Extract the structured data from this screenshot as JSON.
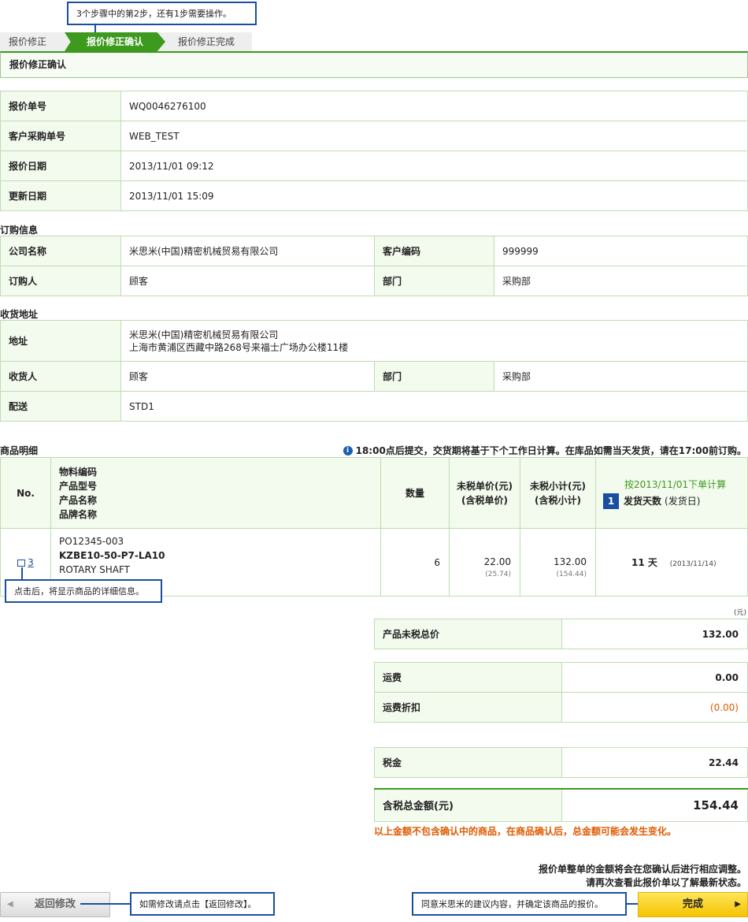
{
  "callouts": {
    "step": "3个步骤中的第2步，还有1步需要操作。",
    "detail": "点击后，将显示商品的详细信息。",
    "back": "如需修改请点击【返回修改】。",
    "confirm": "同意米思米的建议内容，并确定该商品的报价。"
  },
  "steps": [
    "报价修正",
    "报价修正确认",
    "报价修正完成"
  ],
  "page_title": "报价修正确认",
  "quote": {
    "rows": [
      {
        "label": "报价单号",
        "value": "WQ0046276100"
      },
      {
        "label": "客户采购单号",
        "value": "WEB_TEST"
      },
      {
        "label": "报价日期",
        "value": "2013/11/01 09:12"
      },
      {
        "label": "更新日期",
        "value": "2013/11/01 15:09"
      }
    ]
  },
  "order": {
    "section": "订购信息",
    "company_label": "公司名称",
    "company": "米思米(中国)精密机械贸易有限公司",
    "code_label": "客户编码",
    "code": "999999",
    "person_label": "订购人",
    "person": "顾客",
    "dept_label": "部门",
    "dept": "采购部"
  },
  "shipping": {
    "section": "收货地址",
    "addr_label": "地址",
    "addr_line1": "米思米(中国)精密机械贸易有限公司",
    "addr_line2": "上海市黄浦区西藏中路268号来福士广场办公楼11楼",
    "recv_label": "收货人",
    "recv": "顾客",
    "dept_label": "部门",
    "dept": "采购部",
    "delivery_label": "配送",
    "delivery": "STD1"
  },
  "items": {
    "section": "商品明细",
    "notice": "18:00点后提交，交货期将基于下个工作日计算。在库品如需当天发货，请在17:00前订购。",
    "headers": {
      "no": "No.",
      "info1": "物料编码",
      "info2": "产品型号",
      "info3": "产品名称",
      "info4": "品牌名称",
      "qty": "数量",
      "price1": "未税单价(元)",
      "price2": "(含税单价)",
      "sub1": "未税小计(元)",
      "sub2": "(含税小计)",
      "ship_note": "按2013/11/01下单计算",
      "ship_badge": "1",
      "ship_label": "发货天数",
      "ship_sub": "(发货日)"
    },
    "row": {
      "no": "3",
      "code": "PO12345-003",
      "model": "KZBE10-50-P7-LA10",
      "name": "ROTARY SHAFT",
      "qty": "6",
      "price": "22.00",
      "price_tax": "(25.74)",
      "subtotal": "132.00",
      "subtotal_tax": "(154.44)",
      "days": "11 天",
      "ship_date": "(2013/11/14)"
    }
  },
  "summary": {
    "unit": "(元)",
    "net_label": "产品未税总价",
    "net": "132.00",
    "freight_label": "运费",
    "freight": "0.00",
    "freight_disc_label": "运费折扣",
    "freight_disc": "(0.00)",
    "tax_label": "税金",
    "tax": "22.44",
    "total_label": "含税总金额(元)",
    "total": "154.44",
    "warning": "以上金额不包含确认中的商品，在商品确认后，总金额可能会发生变化。",
    "note1": "报价单整单的金额将会在您确认后进行相应调整。",
    "note2": "请再次查看此报价单以了解最新状态。"
  },
  "buttons": {
    "back": "返回修改",
    "done": "完成"
  },
  "colors": {
    "accent_green": "#3d9a1e",
    "callout_blue": "#1a4fa0",
    "warning_orange": "#e05a00",
    "button_yellow": "#f5c300"
  }
}
